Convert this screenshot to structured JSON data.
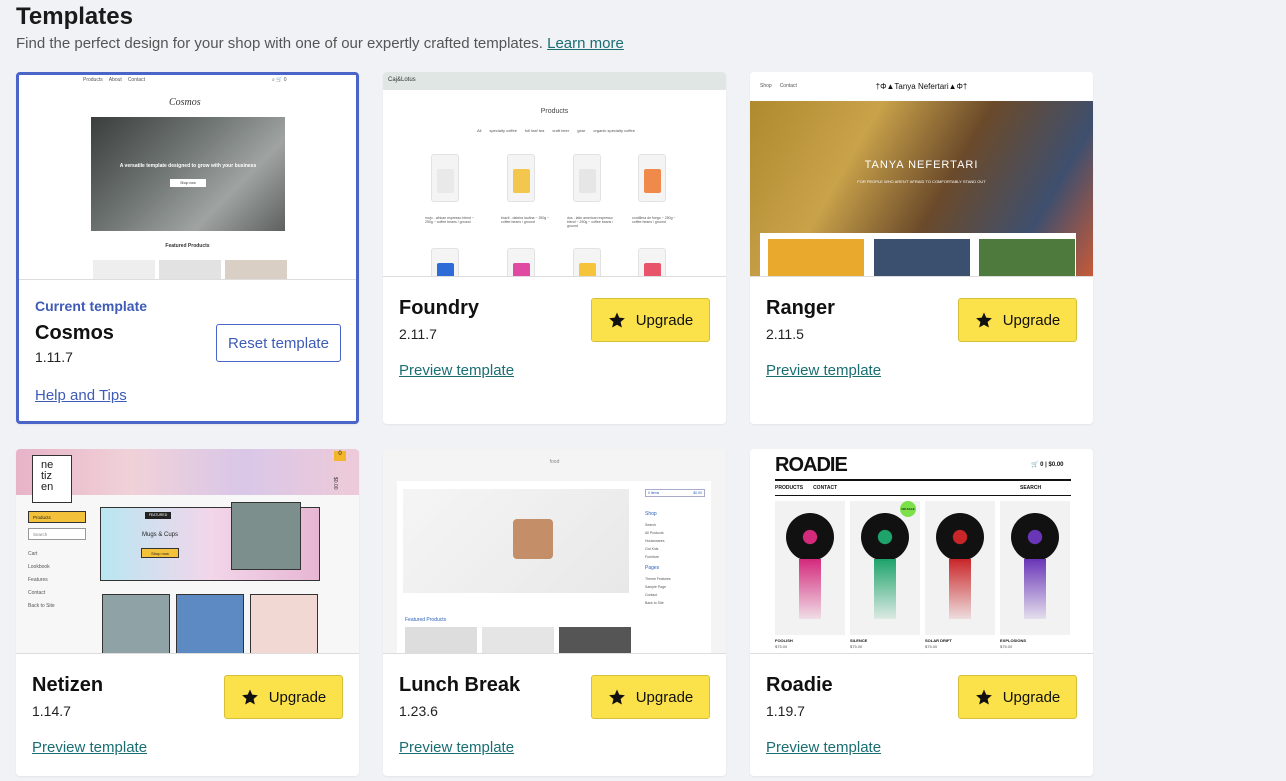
{
  "header": {
    "title": "Templates",
    "subtitle": "Find the perfect design for your shop with one of our expertly crafted templates.",
    "learn_more": "Learn more"
  },
  "colors": {
    "accent_blue": "#3e5bb5",
    "link_teal": "#1a6e72",
    "upgrade_yellow": "#fbe14a",
    "background": "#f1f2f6"
  },
  "current": {
    "label": "Current template",
    "name": "Cosmos",
    "version": "1.11.7",
    "reset_label": "Reset template",
    "help_label": "Help and Tips",
    "thumb": {
      "nav": [
        "Products",
        "About",
        "Contact"
      ],
      "logo": "Cosmos",
      "hero_text": "A versatile template designed to grow with your business",
      "hero_button": "Shop now",
      "section": "Featured Products"
    }
  },
  "templates": [
    {
      "name": "Foundry",
      "version": "2.11.7",
      "upgrade_label": "Upgrade",
      "preview_label": "Preview template",
      "thumb": {
        "logo": "Caj&Lotus",
        "heading": "Products",
        "filters": [
          "All",
          "specialty coffee",
          "full leaf tea",
          "craft beer",
          "gear",
          "organic specialty coffee"
        ],
        "captions": [
          "mojo - african espresso blend ~ 250g ~ coffee beans / ground",
          "brazil - dateira lautina ~ 250g ~ coffee beans / ground",
          "dos - latin american espresso blend ~ 250g ~ coffee beans / ground",
          "cordillera de fuego ~ 250g ~ coffee beans / ground"
        ]
      }
    },
    {
      "name": "Ranger",
      "version": "2.11.5",
      "upgrade_label": "Upgrade",
      "preview_label": "Preview template",
      "thumb": {
        "nav": [
          "Shop",
          "Contact"
        ],
        "logo": "†Φ▲Tanya Nefertari▲Φ†",
        "hero_title": "TANYA NEFERTARI",
        "hero_sub": "FOR PEOPLE WHO AREN'T AFRAID TO COMFORTABLY STAND OUT"
      }
    },
    {
      "name": "Netizen",
      "version": "1.14.7",
      "upgrade_label": "Upgrade",
      "preview_label": "Preview template",
      "thumb": {
        "logo": [
          "ne",
          "tiz",
          "en"
        ],
        "cart_count": "0",
        "side_price": "$0.00",
        "dropdown": "Products",
        "search": "Search",
        "menu": [
          "Cart",
          "Lookbook",
          "Features",
          "Contact",
          "Back to Site"
        ],
        "featured_tag": "FEATURED",
        "hero_title": "Mugs & Cups",
        "hero_button": "Shop now"
      }
    },
    {
      "name": "Lunch Break",
      "version": "1.23.6",
      "upgrade_label": "Upgrade",
      "preview_label": "Preview template",
      "thumb": {
        "logo": "food",
        "cart": "0 items",
        "cart_price": "$0.00",
        "side_shop": "Shop",
        "side_links": [
          "Search",
          "All Products",
          "Housewares",
          "Got Kids",
          "Furniture"
        ],
        "side_pages": "Pages",
        "page_links": [
          "Theme Features",
          "Sample Page",
          "Contact",
          "Back to Site"
        ],
        "featured": "Featured Products"
      }
    },
    {
      "name": "Roadie",
      "version": "1.19.7",
      "upgrade_label": "Upgrade",
      "preview_label": "Preview template",
      "thumb": {
        "logo": "ROADIE",
        "cart": "0 | $0.00",
        "nav": [
          "PRODUCTS",
          "CONTACT"
        ],
        "search": "SEARCH",
        "badge": "ON SALE",
        "products": [
          {
            "name": "FOOLISH",
            "price": "$75.00",
            "color": "#d42a7c"
          },
          {
            "name": "SILENCE",
            "price": "$75.00",
            "color": "#1ea36b"
          },
          {
            "name": "SOLAR DRIFT",
            "price": "$75.00",
            "color": "#c9262a"
          },
          {
            "name": "EXPLOSIONS",
            "price": "$75.00",
            "color": "#6a36b8"
          }
        ]
      }
    }
  ]
}
